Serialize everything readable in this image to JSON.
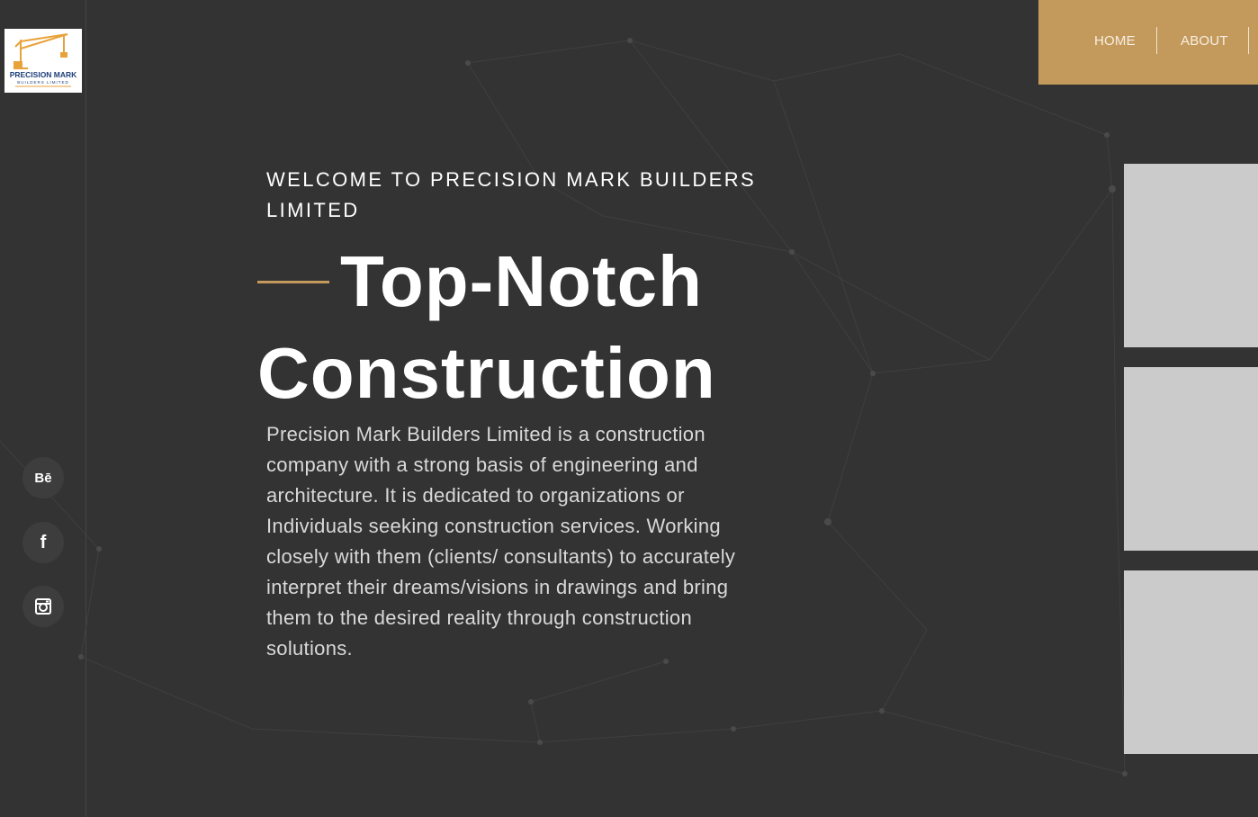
{
  "logo": {
    "line1": "PRECISION MARK",
    "line2": "BUILDERS LIMITED"
  },
  "nav": {
    "items": [
      "HOME",
      "ABOUT"
    ]
  },
  "hero": {
    "welcome": "WELCOME TO PRECISION MARK BUILDERS LIMITED",
    "title_line1": "Top-Notch",
    "title_line2": "Construction",
    "description": "Precision Mark Builders Limited is a construction company with a strong basis of engineering and architecture. It is dedicated to organizations or Individuals seeking construction services. Working closely with them (clients/ consultants) to accurately interpret their dreams/visions in drawings and bring them to the desired reality through construction solutions."
  },
  "social": [
    {
      "label": "Bē",
      "icon": "behance-icon"
    },
    {
      "label": "f",
      "icon": "facebook-icon"
    },
    {
      "label": "",
      "icon": "instagram-icon"
    }
  ],
  "colors": {
    "background": "#333333",
    "accent": "#c49a5c",
    "panel": "#cbcbcb"
  }
}
